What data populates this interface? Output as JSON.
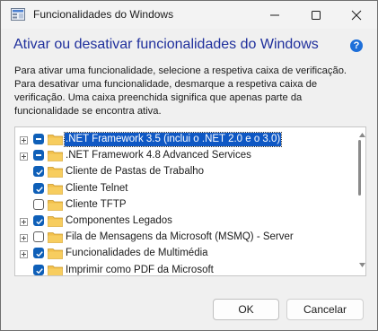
{
  "window": {
    "title": "Funcionalidades do Windows"
  },
  "header": {
    "heading": "Ativar ou desativar funcionalidades do Windows",
    "help_icon": "question-mark-icon",
    "help_glyph": "?",
    "description": "Para ativar uma funcionalidade, selecione a respetiva caixa de verificação. Para desativar uma funcionalidade, desmarque a respetiva caixa de verificação. Uma caixa preenchida significa que apenas parte da funcionalidade se encontra ativa."
  },
  "features": [
    {
      "label": ".NET Framework 3.5 (inclui o .NET 2.0 e o 3.0)",
      "state": "partial",
      "expandable": true,
      "selected": true
    },
    {
      "label": ".NET Framework 4.8 Advanced Services",
      "state": "partial",
      "expandable": true,
      "selected": false
    },
    {
      "label": "Cliente de Pastas de Trabalho",
      "state": "checked",
      "expandable": false,
      "selected": false
    },
    {
      "label": "Cliente Telnet",
      "state": "checked",
      "expandable": false,
      "selected": false
    },
    {
      "label": "Cliente TFTP",
      "state": "unchecked",
      "expandable": false,
      "selected": false
    },
    {
      "label": "Componentes Legados",
      "state": "checked",
      "expandable": true,
      "selected": false
    },
    {
      "label": "Fila de Mensagens da Microsoft (MSMQ) - Server",
      "state": "unchecked",
      "expandable": true,
      "selected": false
    },
    {
      "label": "Funcionalidades de Multimédia",
      "state": "checked",
      "expandable": true,
      "selected": false
    },
    {
      "label": "Imprimir como PDF da Microsoft",
      "state": "checked",
      "expandable": false,
      "selected": false
    }
  ],
  "footer": {
    "ok_label": "OK",
    "cancel_label": "Cancelar"
  },
  "colors": {
    "accent": "#0e5fb8",
    "heading": "#1f2f9c",
    "selection": "#0f58c4",
    "folder": "#f2c04b"
  }
}
